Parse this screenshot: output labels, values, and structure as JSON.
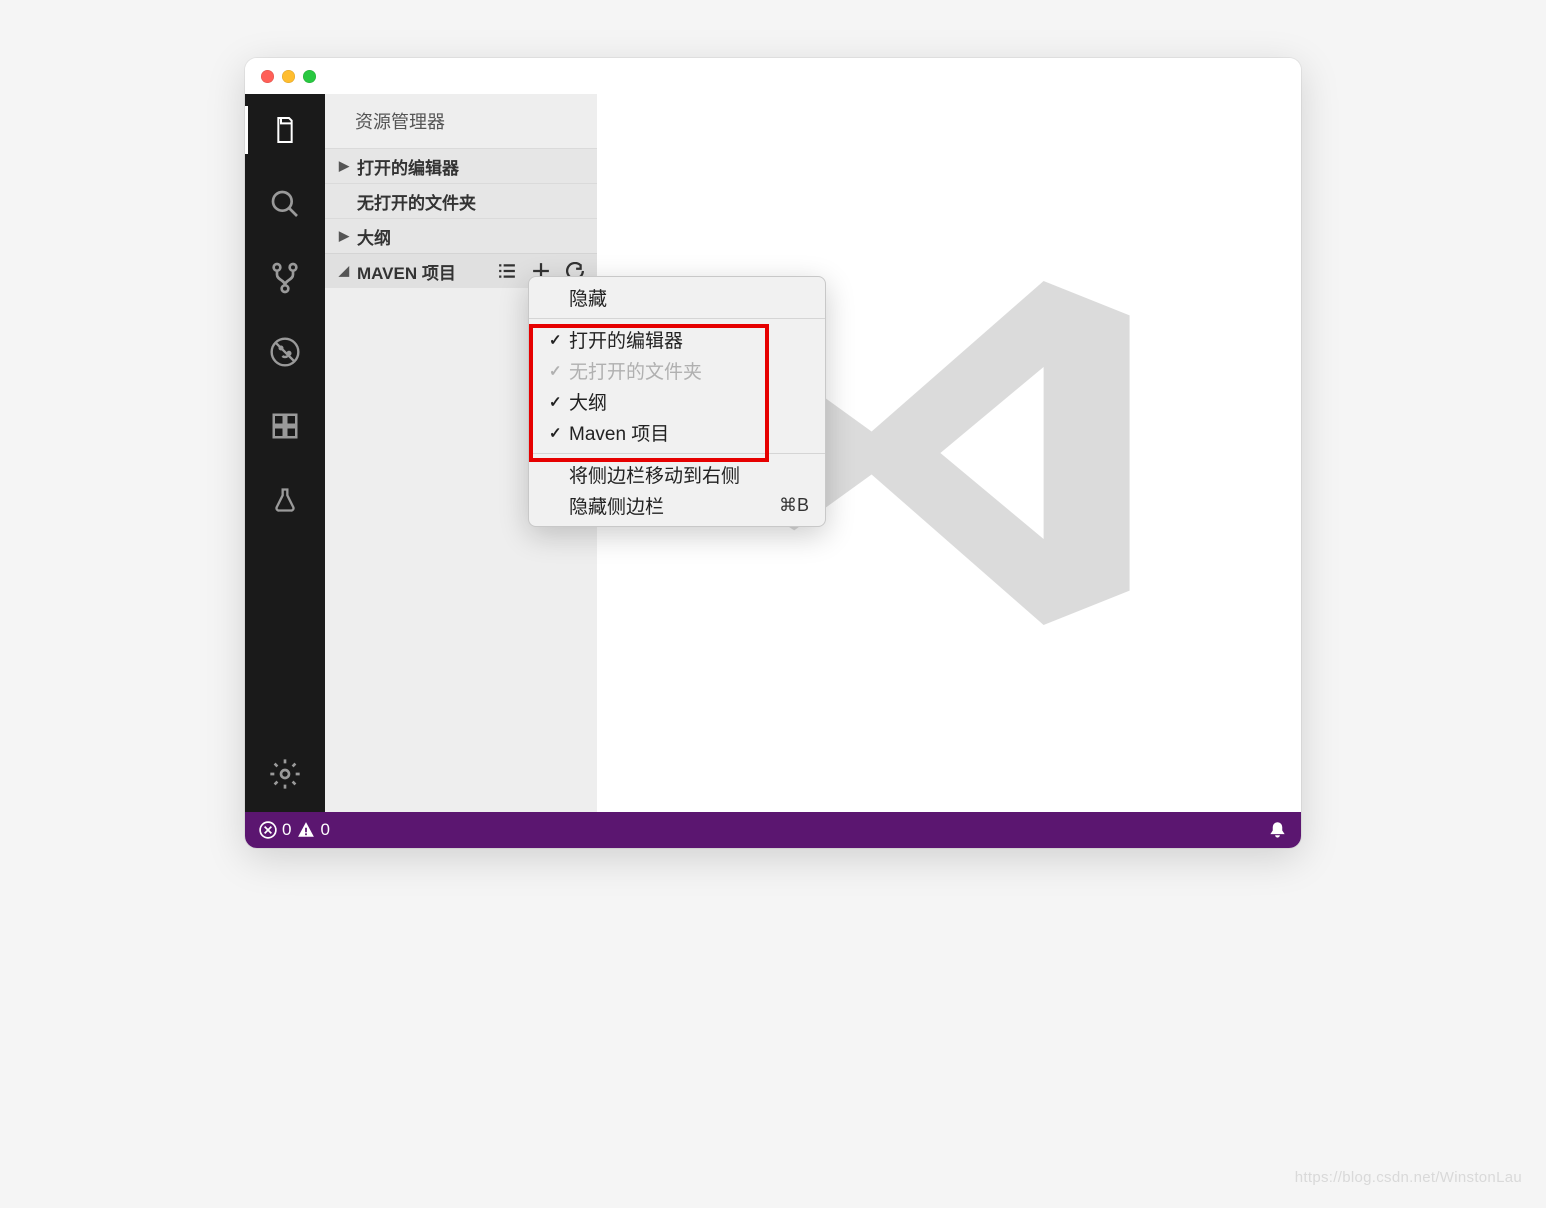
{
  "sidebar": {
    "title": "资源管理器",
    "sections": [
      {
        "label": "打开的编辑器",
        "expanded": false
      },
      {
        "label": "无打开的文件夹",
        "expanded": false,
        "noChevron": true
      },
      {
        "label": "大纲",
        "expanded": false
      },
      {
        "label": "MAVEN 项目",
        "expanded": true
      }
    ]
  },
  "contextMenu": {
    "hide": "隐藏",
    "items": [
      {
        "label": "打开的编辑器",
        "checked": true
      },
      {
        "label": "无打开的文件夹",
        "checked": true,
        "disabled": true
      },
      {
        "label": "大纲",
        "checked": true
      },
      {
        "label": "Maven 项目",
        "checked": true
      }
    ],
    "moveSidebar": "将侧边栏移动到右侧",
    "hideSidebar": "隐藏侧边栏",
    "hideSidebarShortcut": "⌘B"
  },
  "statusbar": {
    "errors": "0",
    "warnings": "0"
  },
  "watermark": "https://blog.csdn.net/WinstonLau"
}
